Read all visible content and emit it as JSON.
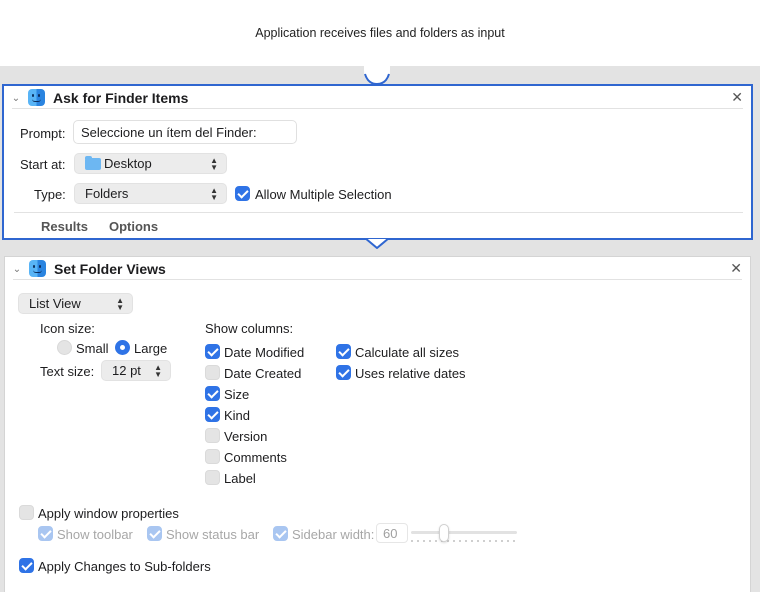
{
  "banner": {
    "text": "Application receives files and folders as input"
  },
  "colors": {
    "accent": "#2f73e6",
    "selection_border": "#2f66d0"
  },
  "action1": {
    "title": "Ask for Finder Items",
    "icon": "finder-icon",
    "prompt_label": "Prompt:",
    "prompt_value": "Seleccione un ítem del Finder:",
    "start_label": "Start at:",
    "start_value": "Desktop",
    "type_label": "Type:",
    "type_value": "Folders",
    "allow_multiple_label": "Allow Multiple Selection",
    "allow_multiple_checked": true,
    "tabs": [
      "Results",
      "Options"
    ]
  },
  "action2": {
    "title": "Set Folder Views",
    "icon": "finder-icon",
    "view_value": "List View",
    "icon_size_label": "Icon size:",
    "small_label": "Small",
    "large_label": "Large",
    "icon_size_selected": "Large",
    "text_size_label": "Text size:",
    "text_size_value": "12 pt",
    "show_columns_label": "Show columns:",
    "columns": [
      {
        "label": "Date Modified",
        "checked": true
      },
      {
        "label": "Date Created",
        "checked": false
      },
      {
        "label": "Size",
        "checked": true
      },
      {
        "label": "Kind",
        "checked": true
      },
      {
        "label": "Version",
        "checked": false
      },
      {
        "label": "Comments",
        "checked": false
      },
      {
        "label": "Label",
        "checked": false
      }
    ],
    "extra_columns": [
      {
        "label": "Calculate all sizes",
        "checked": true
      },
      {
        "label": "Uses relative dates",
        "checked": true
      }
    ],
    "apply_window_label": "Apply window properties",
    "apply_window_checked": false,
    "show_toolbar_label": "Show toolbar",
    "show_status_bar_label": "Show status bar",
    "sidebar_width_label": "Sidebar width:",
    "sidebar_width_value": "60",
    "apply_subfolders_label": "Apply Changes to Sub-folders",
    "apply_subfolders_checked": true
  }
}
